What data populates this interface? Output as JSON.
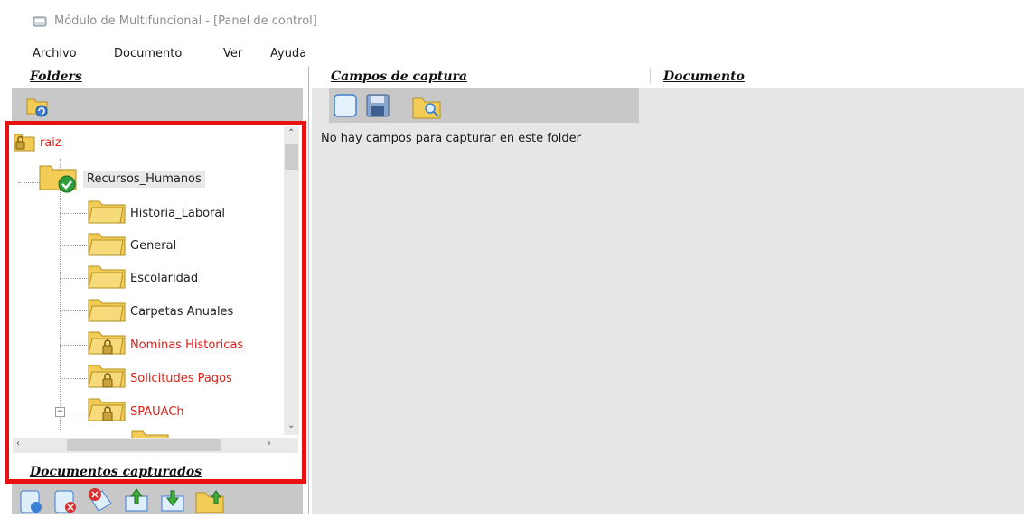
{
  "window": {
    "title": "Módulo de Multifuncional - [Panel de control]",
    "icon": "app-window-icon"
  },
  "menu": [
    "Archivo",
    "Documento",
    "Ver",
    "Ayuda"
  ],
  "panels": {
    "folders": "Folders",
    "campos": "Campos de captura",
    "documento": "Documento",
    "documentos_capturados": "Documentos capturados"
  },
  "campos_message": "No hay campos para capturar en este folder",
  "tree": {
    "root": "raiz",
    "recursos": "Recursos_Humanos",
    "children": [
      {
        "label": "Historia_Laboral",
        "locked": false
      },
      {
        "label": "General",
        "locked": false
      },
      {
        "label": "Escolaridad",
        "locked": false
      },
      {
        "label": "Carpetas Anuales",
        "locked": false
      },
      {
        "label": "Nominas Historicas",
        "locked": true
      },
      {
        "label": "Solicitudes Pagos",
        "locked": true
      },
      {
        "label": "SPAUACh",
        "locked": true
      }
    ]
  },
  "colors": {
    "locked_text": "#e0201a",
    "highlight_border": "#e81010",
    "folder_yellow": "#f2cc55"
  }
}
